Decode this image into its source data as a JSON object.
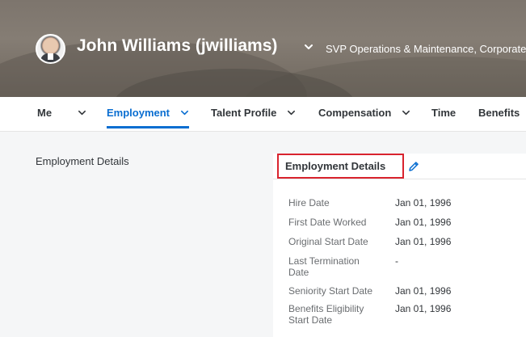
{
  "profile": {
    "name": "John Williams (jwilliams)",
    "job_title": "SVP Operations & Maintenance, Corporate -"
  },
  "tabs": [
    {
      "label": "Me",
      "has_chevron": true,
      "active": false
    },
    {
      "label": "Employment",
      "has_chevron": true,
      "active": true
    },
    {
      "label": "Talent Profile",
      "has_chevron": true,
      "active": false
    },
    {
      "label": "Compensation",
      "has_chevron": true,
      "active": false
    },
    {
      "label": "Time",
      "has_chevron": false,
      "active": false
    },
    {
      "label": "Benefits",
      "has_chevron": false,
      "active": false
    }
  ],
  "section": {
    "label": "Employment Details"
  },
  "card": {
    "title": "Employment Details",
    "fields": [
      {
        "label": "Hire Date",
        "value": "Jan 01, 1996"
      },
      {
        "label": "First Date Worked",
        "value": "Jan 01, 1996"
      },
      {
        "label": "Original Start Date",
        "value": "Jan 01, 1996"
      },
      {
        "label": "Last Termination Date",
        "value": "-"
      },
      {
        "label": "Seniority Start Date",
        "value": "Jan 01, 1996"
      },
      {
        "label": "Benefits Eligibility Start Date",
        "value": "Jan 01, 1996"
      }
    ]
  },
  "colors": {
    "accent": "#0a6ed1",
    "highlight_border": "#d9232e"
  },
  "icons": {
    "edit": "pencil-icon",
    "dropdown": "chevron-down-icon"
  }
}
